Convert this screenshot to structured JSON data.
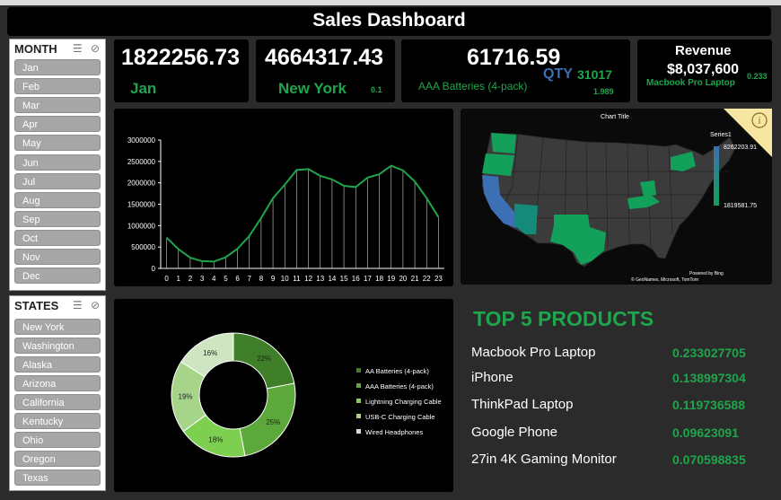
{
  "header": {
    "title": "Sales Dashboard"
  },
  "kpis": {
    "month_sales": "1822256.73",
    "month_name": "Jan",
    "state_sales": "4664317.43",
    "state_name": "New York",
    "state_ratio": "0.1",
    "product_sales": "61716.59",
    "qty_label": "QTY",
    "qty_value": "31017",
    "product_name": "AAA Batteries (4-pack)",
    "product_ratio": "1.989",
    "revenue_label": "Revenue",
    "revenue_value": "$8,037,600",
    "revenue_product": "Macbook Pro Laptop",
    "revenue_ratio": "0.233"
  },
  "month_slicer": {
    "header": "MONTH",
    "items": [
      "Jan",
      "Feb",
      "Mar",
      "Apr",
      "May",
      "Jun",
      "Jul",
      "Aug",
      "Sep",
      "Oct",
      "Nov",
      "Dec"
    ]
  },
  "states_slicer": {
    "header": "STATES",
    "items": [
      "New York",
      "Washington",
      "Alaska",
      "Arizona",
      "California",
      "Kentucky",
      "Ohio",
      "Oregon",
      "Texas"
    ]
  },
  "map": {
    "title": "Chart Title",
    "legend_title": "Series1",
    "legend_max": "8262203.91",
    "legend_min": "1819581.75",
    "credit1": "Powered by Bing",
    "credit2": "© GeoNames, Microsoft, TomTom",
    "info_icon": "info-icon"
  },
  "top5": {
    "title": "TOP 5 PRODUCTS",
    "items": [
      {
        "name": "Macbook Pro Laptop",
        "value": "0.233027705"
      },
      {
        "name": "iPhone",
        "value": "0.138997304"
      },
      {
        "name": "ThinkPad Laptop",
        "value": "0.119736588"
      },
      {
        "name": "Google Phone",
        "value": "0.09623091"
      },
      {
        "name": "27in 4K Gaming Monitor",
        "value": "0.070598835"
      }
    ]
  },
  "colors": {
    "green": "#1fa54b",
    "blue": "#3c6fb4",
    "card": "#000000",
    "bg": "#2b2b2b"
  },
  "chart_data": [
    {
      "type": "line",
      "x": [
        0,
        1,
        2,
        3,
        4,
        5,
        6,
        7,
        8,
        9,
        10,
        11,
        12,
        13,
        14,
        15,
        16,
        17,
        18,
        19,
        20,
        21,
        22,
        23
      ],
      "series": [
        {
          "values": [
            720000,
            450000,
            250000,
            170000,
            160000,
            260000,
            460000,
            760000,
            1180000,
            1640000,
            1960000,
            2300000,
            2320000,
            2160000,
            2080000,
            1930000,
            1900000,
            2120000,
            2200000,
            2400000,
            2290000,
            2030000,
            1640000,
            1200000
          ]
        }
      ],
      "yticks": [
        "0",
        "500000",
        "1000000",
        "1500000",
        "2000000",
        "2500000",
        "3000000"
      ],
      "ylim": [
        0,
        3000000
      ],
      "color": "#1fa54b"
    },
    {
      "type": "pie",
      "categories": [
        "AA Batteries (4-pack)",
        "AAA Batteries (4-pack)",
        "Lightning Charging Cable",
        "USB-C Charging Cable",
        "Wired Headphones"
      ],
      "values": [
        22,
        25,
        18,
        19,
        16
      ],
      "labels": [
        "22%",
        "25%",
        "18%",
        "19%",
        "16%"
      ],
      "colors": [
        "#3f7f2a",
        "#5ca83a",
        "#7ccf4f",
        "#a6d58a",
        "#cfe5c2"
      ]
    }
  ]
}
